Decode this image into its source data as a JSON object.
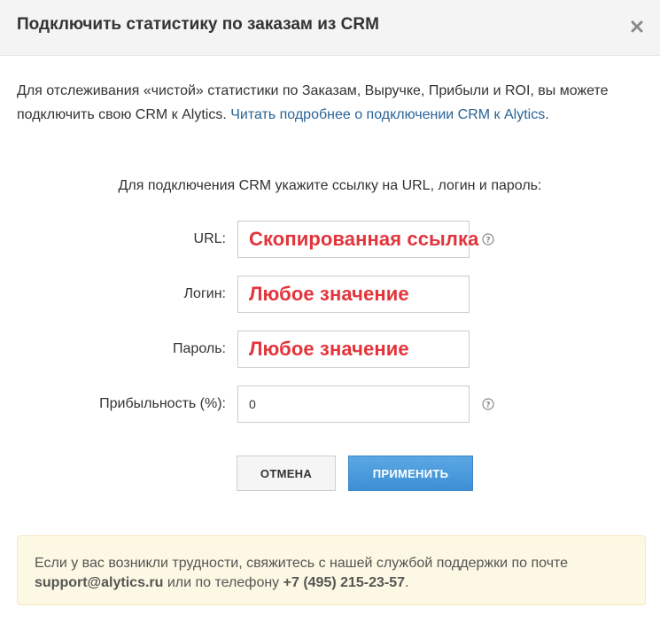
{
  "modal": {
    "title": "Подключить статистику по заказам из CRM",
    "close_icon": "close-icon"
  },
  "intro": {
    "text": "Для отслеживания «чистой» статистики по Заказам, Выручке, Прибыли и ROI, вы можете подключить свою CRM к Alytics.",
    "link_text": "Читать подробнее о подключении CRM к Alytics",
    "tail": "."
  },
  "instruction": "Для подключения CRM укажите ссылку на URL, логин и пароль:",
  "form": {
    "url": {
      "label": "URL:",
      "value": "Скопированная ссылка"
    },
    "login": {
      "label": "Логин:",
      "value": "Любое значение"
    },
    "password": {
      "label": "Пароль:",
      "value": "Любое значение"
    },
    "profit": {
      "label": "Прибыльность (%):",
      "value": "0"
    },
    "help_icon": "help-circle-icon"
  },
  "buttons": {
    "cancel": "ОТМЕНА",
    "apply": "ПРИМЕНИТЬ"
  },
  "notice": {
    "text1": "Если у вас возникли трудности, свяжитесь с нашей службой поддержки по почте",
    "email": "support@alytics.ru",
    "text2": "или по телефону",
    "phone": "+7 (495) 215-23-57",
    "text3": "."
  },
  "colors": {
    "link": "#2a6496",
    "annotation_red": "#e2343b",
    "apply_button": "#4a9be0",
    "notice_bg": "#fcf8e3"
  }
}
